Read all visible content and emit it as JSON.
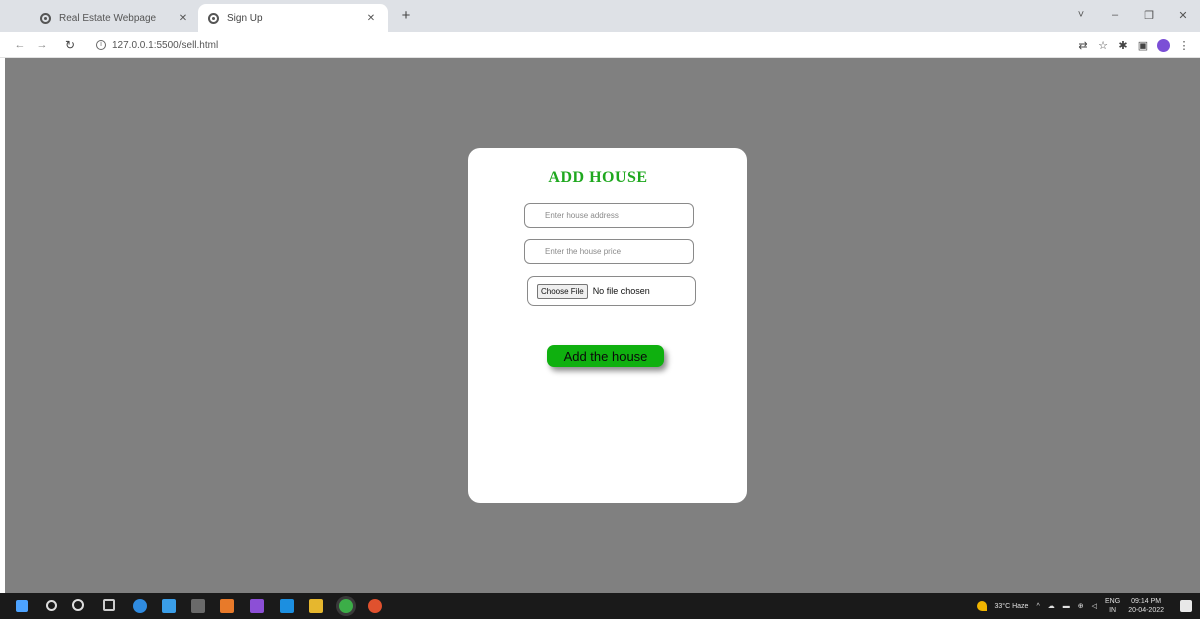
{
  "browser": {
    "tabs": [
      {
        "title": "Real Estate Webpage",
        "active": false
      },
      {
        "title": "Sign Up",
        "active": true
      }
    ],
    "new_tab_symbol": "+",
    "url": "127.0.0.1:5500/sell.html",
    "window_controls": [
      "˅",
      "–",
      "❐",
      "✕"
    ]
  },
  "page": {
    "background_color": "#808080",
    "form": {
      "title": "ADD HOUSE",
      "title_color": "#1fa81f",
      "address_placeholder": "Enter house address",
      "price_placeholder": "Enter the house price",
      "file_button_label": "Choose File",
      "file_status": "No file chosen",
      "submit_label": "Add the house",
      "submit_color": "#0fb00f"
    }
  },
  "taskbar": {
    "weather": "33°C Haze",
    "language": {
      "top": "ENG",
      "bottom": "IN"
    },
    "time": "09:14 PM",
    "date": "20-04-2022"
  }
}
